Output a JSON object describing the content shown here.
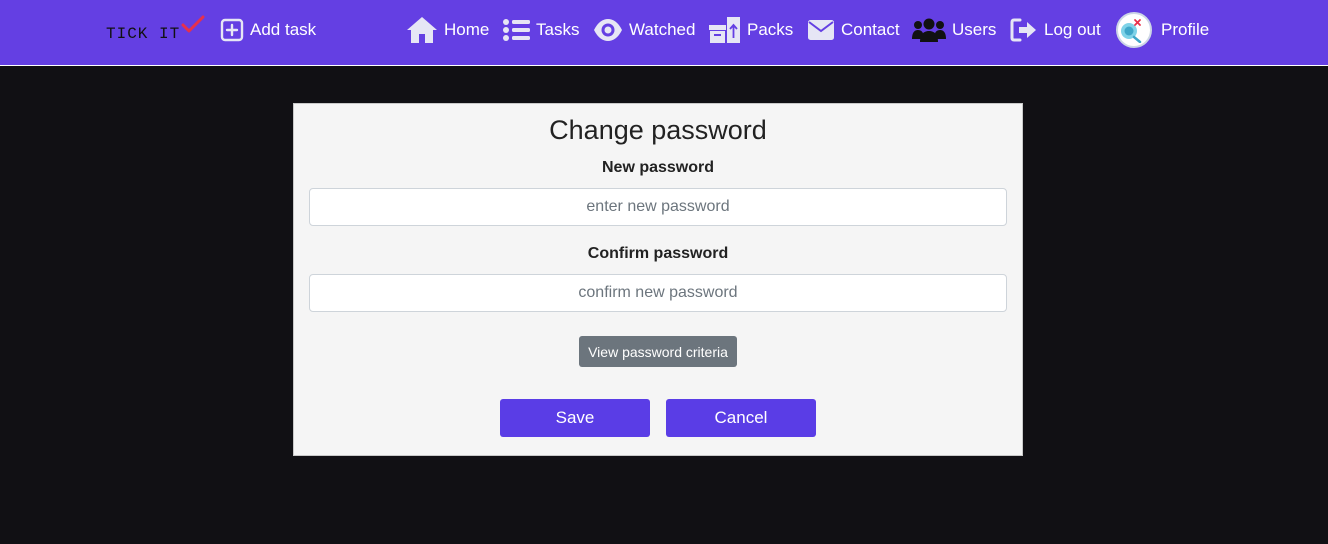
{
  "brand": {
    "text": "TICK IT"
  },
  "nav": {
    "add_task": "Add task",
    "home": "Home",
    "tasks": "Tasks",
    "watched": "Watched",
    "packs": "Packs",
    "contact": "Contact",
    "users": "Users",
    "logout": "Log out",
    "profile": "Profile"
  },
  "form": {
    "title": "Change password",
    "new_password_label": "New password",
    "new_password_placeholder": "enter new password",
    "new_password_value": "",
    "confirm_password_label": "Confirm password",
    "confirm_password_placeholder": "confirm new password",
    "confirm_password_value": "",
    "criteria_button": "View password criteria",
    "save_button": "Save",
    "cancel_button": "Cancel"
  },
  "colors": {
    "navbar": "#643fe3",
    "primary_button": "#5a3de6",
    "secondary_button": "#6c757d",
    "page_background": "#111014",
    "card_background": "#f5f5f5",
    "brand_check": "#e8304a"
  },
  "icons": {
    "add_task": "plus-square-icon",
    "home": "home-icon",
    "tasks": "list-icon",
    "watched": "eye-icon",
    "packs": "archive-boxes-icon",
    "contact": "envelope-icon",
    "users": "users-icon",
    "logout": "logout-icon",
    "profile": "avatar-icon"
  }
}
